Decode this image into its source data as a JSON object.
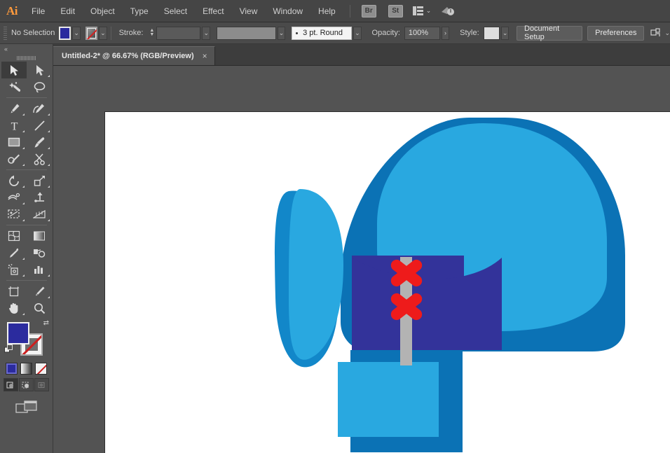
{
  "app": {
    "name": "Adobe Illustrator",
    "logo": "Ai"
  },
  "menubar": {
    "items": [
      {
        "label": "File"
      },
      {
        "label": "Edit"
      },
      {
        "label": "Object"
      },
      {
        "label": "Type"
      },
      {
        "label": "Select"
      },
      {
        "label": "Effect"
      },
      {
        "label": "View"
      },
      {
        "label": "Window"
      },
      {
        "label": "Help"
      }
    ],
    "bridge_label": "Br",
    "stock_label": "St",
    "workspace_icon": "workspace-switcher-icon",
    "workspace_caret": "⌄",
    "search_icon": "search-adobe-stock-icon"
  },
  "controlbar": {
    "selection_status": "No Selection",
    "fill_color": "#2b2b9e",
    "fill_caret": "⌄",
    "stroke_color": "none",
    "stroke_caret": "⌄",
    "stroke_label": "Stroke:",
    "stroke_weight": "",
    "stroke_weight_caret": "⌄",
    "variable_width_profile": "",
    "variable_width_caret": "⌄",
    "brush_definition": "3 pt. Round",
    "brush_caret": "⌄",
    "opacity_label": "Opacity:",
    "opacity_value": "100%",
    "opacity_arrow": "›",
    "style_label": "Style:",
    "style_caret": "⌄",
    "document_setup_label": "Document Setup",
    "preferences_label": "Preferences",
    "arrange_caret": "⌄"
  },
  "tabbar": {
    "document_title": "Untitled-2* @ 66.67% (RGB/Preview)",
    "close_glyph": "×"
  },
  "toolbar": {
    "collapse_glyph": "«",
    "tools": [
      {
        "name": "selection-tool",
        "active": true,
        "has_flyout": false
      },
      {
        "name": "direct-selection-tool",
        "active": false,
        "has_flyout": true
      },
      {
        "name": "magic-wand-tool",
        "active": false,
        "has_flyout": false
      },
      {
        "name": "lasso-tool",
        "active": false,
        "has_flyout": false
      },
      {
        "name": "pen-tool",
        "active": false,
        "has_flyout": true
      },
      {
        "name": "curvature-tool",
        "active": false,
        "has_flyout": false
      },
      {
        "name": "type-tool",
        "active": false,
        "has_flyout": true
      },
      {
        "name": "line-segment-tool",
        "active": false,
        "has_flyout": true
      },
      {
        "name": "rectangle-tool",
        "active": false,
        "has_flyout": true
      },
      {
        "name": "paintbrush-tool",
        "active": false,
        "has_flyout": true
      },
      {
        "name": "shaper-tool",
        "active": false,
        "has_flyout": true
      },
      {
        "name": "scissors-tool",
        "active": false,
        "has_flyout": true
      },
      {
        "name": "rotate-tool",
        "active": false,
        "has_flyout": true
      },
      {
        "name": "scale-tool",
        "active": false,
        "has_flyout": true
      },
      {
        "name": "width-tool",
        "active": false,
        "has_flyout": true
      },
      {
        "name": "free-transform-tool",
        "active": false,
        "has_flyout": false
      },
      {
        "name": "shape-builder-tool",
        "active": false,
        "has_flyout": true
      },
      {
        "name": "perspective-grid-tool",
        "active": false,
        "has_flyout": true
      },
      {
        "name": "mesh-tool",
        "active": false,
        "has_flyout": false
      },
      {
        "name": "gradient-tool",
        "active": false,
        "has_flyout": false
      },
      {
        "name": "eyedropper-tool",
        "active": false,
        "has_flyout": true
      },
      {
        "name": "blend-tool",
        "active": false,
        "has_flyout": false
      },
      {
        "name": "symbol-sprayer-tool",
        "active": false,
        "has_flyout": true
      },
      {
        "name": "column-graph-tool",
        "active": false,
        "has_flyout": true
      },
      {
        "name": "artboard-tool",
        "active": false,
        "has_flyout": false
      },
      {
        "name": "slice-tool",
        "active": false,
        "has_flyout": true
      },
      {
        "name": "hand-tool",
        "active": false,
        "has_flyout": true
      },
      {
        "name": "zoom-tool",
        "active": false,
        "has_flyout": false
      }
    ],
    "fill_color": "#2b2b9e",
    "stroke_color": "none",
    "swap_glyph": "⇄",
    "color_mode_buttons": [
      "color-fill-button",
      "gradient-fill-button",
      "none-fill-button"
    ],
    "drawing_modes": [
      "draw-normal",
      "draw-behind",
      "draw-inside"
    ],
    "screen_mode": "change-screen-mode-icon"
  },
  "artwork": {
    "title": "boxing-glove-illustration",
    "colors": {
      "light_blue": "#29a8e0",
      "mid_blue": "#1287c9",
      "dark_blue": "#0b72b5",
      "indigo": "#33339a",
      "strap_gray": "#b3b3b3",
      "lace_red": "#ee1b1b",
      "background": "#ffffff"
    },
    "shapes": [
      {
        "name": "glove-main-body",
        "color": "#0b72b5"
      },
      {
        "name": "glove-thumb",
        "color": "#1287c9"
      },
      {
        "name": "glove-thumb-highlight",
        "color": "#29a8e0"
      },
      {
        "name": "glove-knuckle-highlight",
        "color": "#29a8e0"
      },
      {
        "name": "glove-cuff-panel",
        "color": "#33339a"
      },
      {
        "name": "glove-wrist-band",
        "color": "#0b72b5"
      },
      {
        "name": "glove-wrist-highlight",
        "color": "#29a8e0"
      },
      {
        "name": "lace-strap",
        "color": "#b3b3b3"
      },
      {
        "name": "lace-cross-upper",
        "color": "#ee1b1b"
      },
      {
        "name": "lace-cross-lower",
        "color": "#ee1b1b"
      }
    ]
  }
}
